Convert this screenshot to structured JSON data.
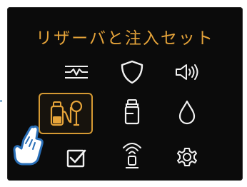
{
  "header": {
    "title": "リザーバと注入セット"
  },
  "menu": {
    "items": [
      {
        "id": "history",
        "icon": "waveform-history-icon"
      },
      {
        "id": "security",
        "icon": "shield-icon"
      },
      {
        "id": "sound",
        "icon": "speaker-volume-icon"
      },
      {
        "id": "reservoir-infusion-set",
        "icon": "reservoir-infusion-set-icon",
        "selected": true
      },
      {
        "id": "insulin",
        "icon": "insulin-vial-icon"
      },
      {
        "id": "fill",
        "icon": "drop-icon"
      },
      {
        "id": "checklist",
        "icon": "checkbox-check-icon"
      },
      {
        "id": "connect",
        "icon": "wireless-connection-icon"
      },
      {
        "id": "settings",
        "icon": "gear-icon"
      }
    ]
  },
  "colors": {
    "background": "#0b0b0b",
    "accent": "#e6a43a",
    "icon_stroke": "#f2f2f2",
    "hand_fill": "#ffffff",
    "hand_outline": "#2a6fb7"
  },
  "overlay": {
    "pointer": "pointing-hand-icon"
  }
}
